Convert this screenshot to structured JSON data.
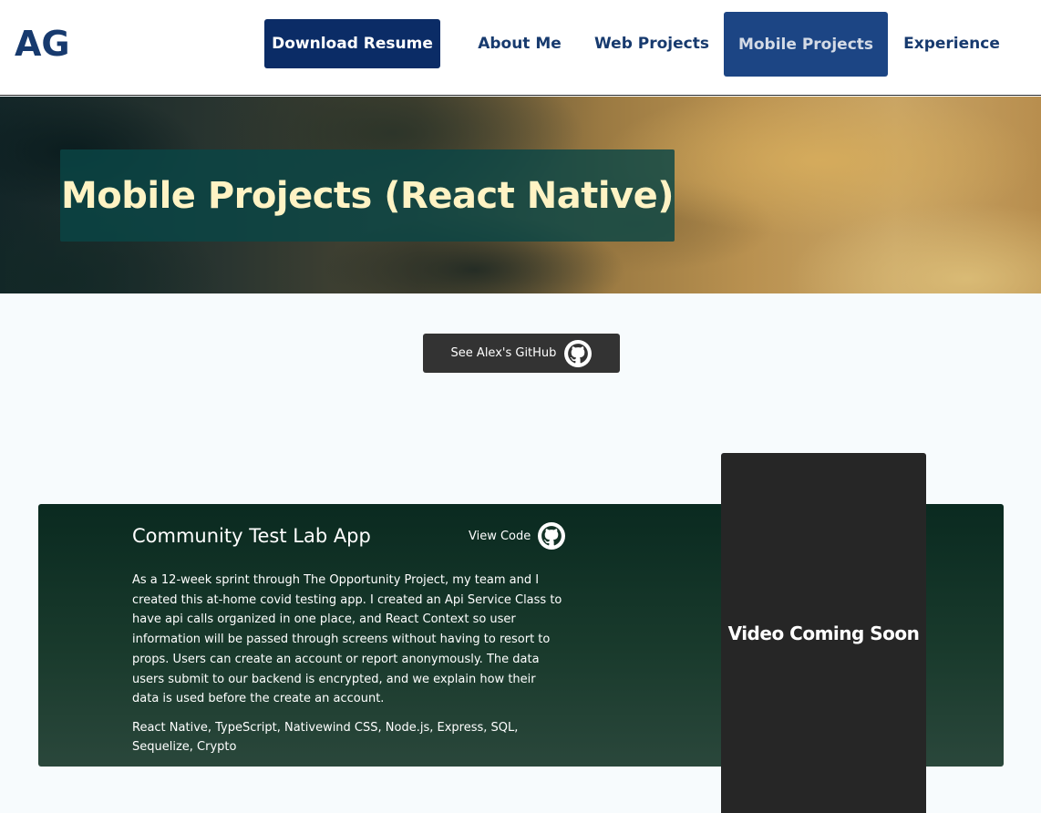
{
  "header": {
    "logo": "AG",
    "nav": {
      "download_resume": "Download Resume",
      "about_me": "About Me",
      "web_projects": "Web Projects",
      "mobile_projects": "Mobile Projects",
      "experience": "Experience"
    },
    "active_nav": "Mobile Projects"
  },
  "hero": {
    "title": "Mobile Projects (React Native)"
  },
  "github_button": {
    "label": "See Alex's GitHub",
    "icon": "github-icon"
  },
  "project": {
    "title": "Community Test Lab App",
    "view_code_label": "View Code",
    "view_code_icon": "github-icon",
    "description": "As a 12-week sprint through The Opportunity Project, my team and I created this at-home covid testing app. I created an Api Service Class to have api calls organized in one place, and React Context so user information will be passed through screens without having to resort to props. Users can create an account or report anonymously. The data users submit to our backend is encrypted, and we explain how their data is used before the create an account.",
    "tech": "React Native, TypeScript, Nativewind CSS, Node.js, Express, SQL, Sequelize, Crypto",
    "video_placeholder": "Video Coming Soon"
  },
  "colors": {
    "brand_navy": "#173a6e",
    "download_button": "#0b2c66",
    "active_nav": "#1c4584",
    "hero_title": "#fff3c4",
    "card_bg": "#193a2c",
    "video_bg": "#262626"
  }
}
